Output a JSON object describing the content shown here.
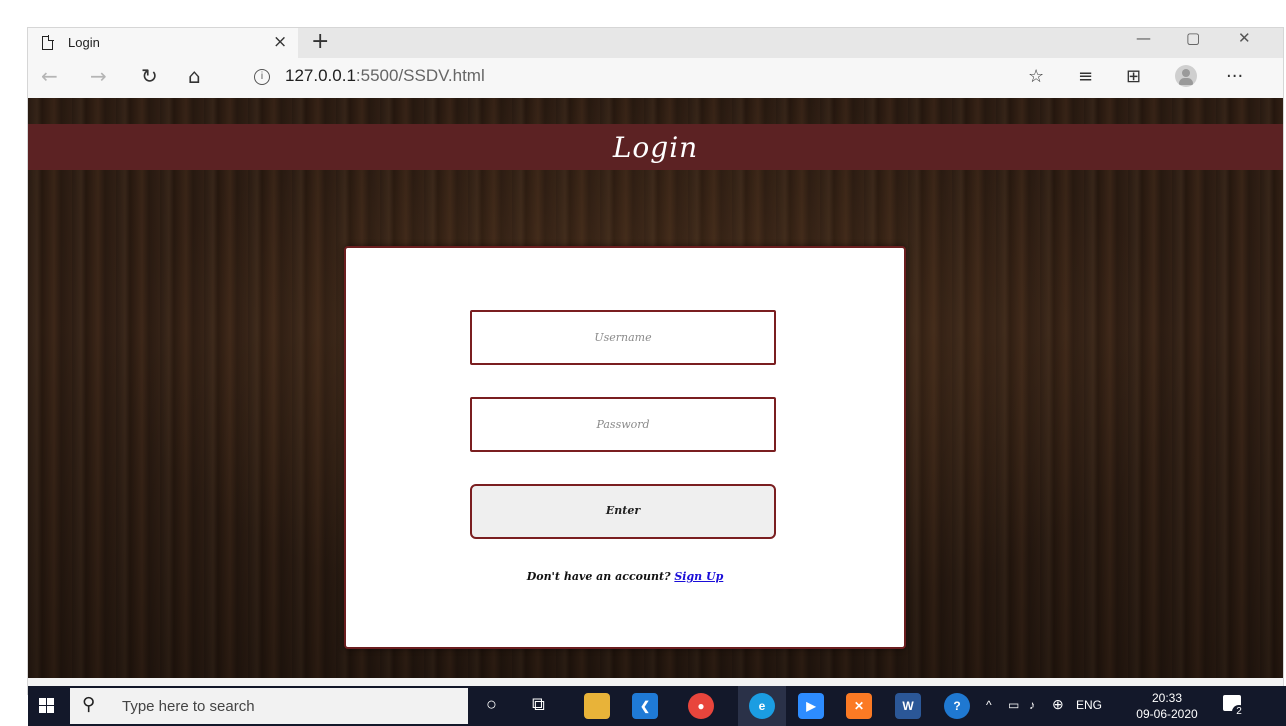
{
  "browser": {
    "tab_title": "Login",
    "tab_close": "×",
    "new_tab": "+",
    "url_host": "127.0.0.1",
    "url_path": ":5500/SSDV.html",
    "info_glyph": "i",
    "more_glyph": "···"
  },
  "page": {
    "header_title": "Login",
    "username_placeholder": "Username",
    "password_placeholder": "Password",
    "enter_label": "Enter",
    "signup_prompt": "Don't have an account? ",
    "signup_link": "Sign Up",
    "accent_color": "#5c2223"
  },
  "taskbar": {
    "search_placeholder": "Type here to search",
    "tray_lang": "ENG",
    "clock_time": "20:33",
    "clock_date": "09-06-2020",
    "notification_count": "2"
  }
}
